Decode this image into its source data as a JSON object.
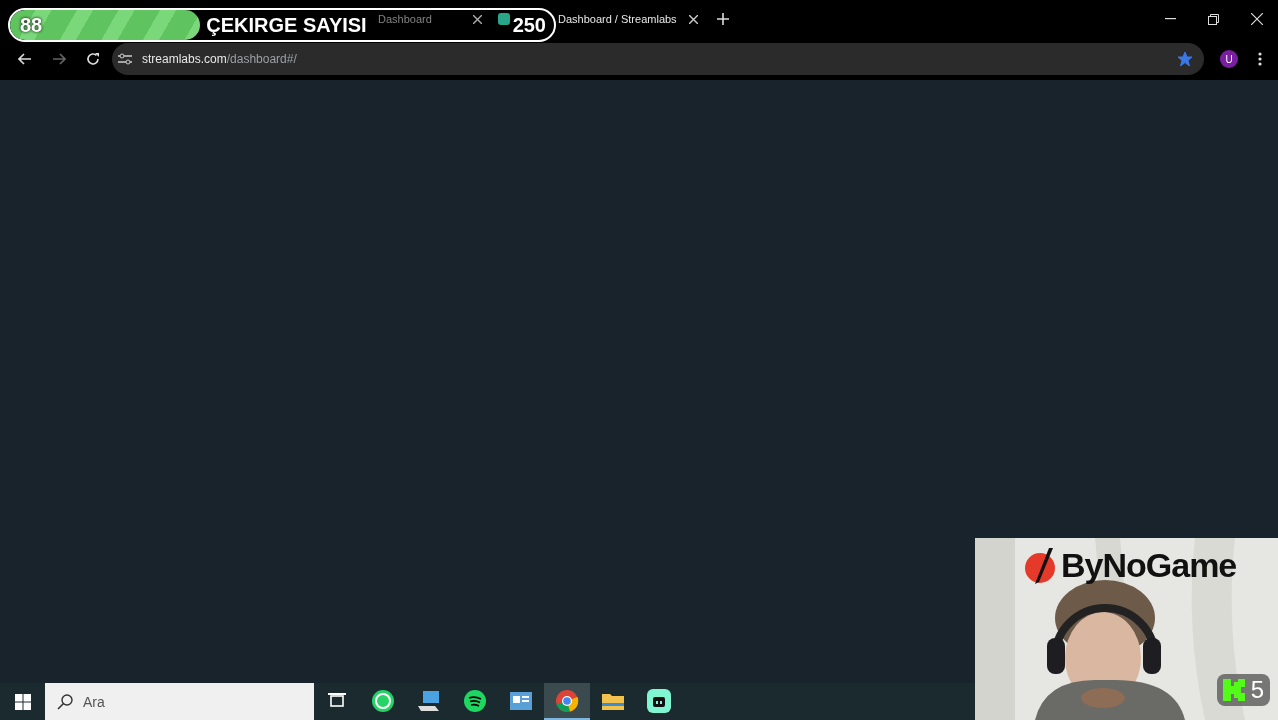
{
  "overlay_counter": {
    "current": "88",
    "label": "ÇEKIRGE SAYISI",
    "goal": "250",
    "level": 0.35
  },
  "tabs": [
    {
      "label": "Dashboard",
      "selected": false
    },
    {
      "label": "Dashboard / Streamlabs",
      "selected": true
    }
  ],
  "address_bar": {
    "host": "streamlabs.com",
    "path": "/dashboard#/",
    "bookmarked": true,
    "profile_initial": "U"
  },
  "taskbar": {
    "search_placeholder": "Ara",
    "apps": [
      {
        "kind": "taskview",
        "active": false
      },
      {
        "kind": "whatsapp",
        "active": false
      },
      {
        "kind": "computer",
        "active": false
      },
      {
        "kind": "spotify",
        "active": false
      },
      {
        "kind": "news",
        "active": false
      },
      {
        "kind": "chrome",
        "active": true
      },
      {
        "kind": "folder",
        "active": false
      },
      {
        "kind": "streamlabs",
        "active": false
      }
    ]
  },
  "webcam": {
    "kind": "picture",
    "logo": "ByNoGame",
    "viewer_count": "5"
  }
}
